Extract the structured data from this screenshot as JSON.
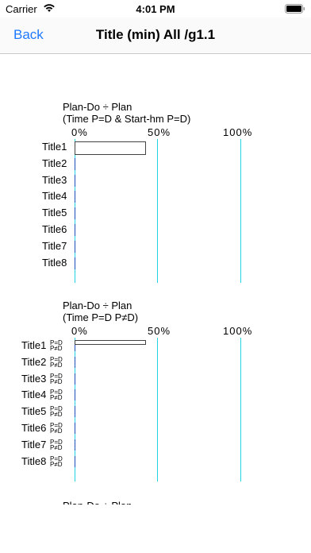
{
  "status": {
    "carrier": "Carrier",
    "time": "4:01 PM"
  },
  "nav": {
    "back_label": "Back",
    "title": "Title (min) All /g1.1"
  },
  "axis": {
    "p0": "0%",
    "p50": "50%",
    "p100": "100%"
  },
  "charts": [
    {
      "title_line1": "Plan-Do ÷ Plan",
      "title_line2": "(Time P=D & Start-hm P=D)",
      "rows": [
        "Title1",
        "Title2",
        "Title3",
        "Title4",
        "Title5",
        "Title6",
        "Title7",
        "Title8"
      ]
    },
    {
      "title_line1": "Plan-Do ÷ Plan",
      "title_line2": "(Time P=D P≠D)",
      "rows": [
        "Title1",
        "Title2",
        "Title3",
        "Title4",
        "Title5",
        "Title6",
        "Title7",
        "Title8"
      ],
      "pd_eq": "P=D",
      "pd_ne": "P≠D"
    }
  ],
  "chart_data": [
    {
      "type": "bar",
      "title": "Plan-Do ÷ Plan (Time P=D & Start-hm P=D)",
      "categories": [
        "Title1",
        "Title2",
        "Title3",
        "Title4",
        "Title5",
        "Title6",
        "Title7",
        "Title8"
      ],
      "values": [
        43,
        0,
        0,
        0,
        0,
        0,
        0,
        0
      ],
      "xlim": [
        0,
        100
      ]
    },
    {
      "type": "bar",
      "title": "Plan-Do ÷ Plan (Time P=D P≠D)",
      "categories": [
        "Title1",
        "Title2",
        "Title3",
        "Title4",
        "Title5",
        "Title6",
        "Title7",
        "Title8"
      ],
      "series": [
        {
          "name": "P=D",
          "values": [
            43,
            0,
            0,
            0,
            0,
            0,
            0,
            0
          ]
        },
        {
          "name": "P≠D",
          "values": [
            0,
            0,
            0,
            0,
            0,
            0,
            0,
            0
          ]
        }
      ],
      "xlim": [
        0,
        100
      ]
    }
  ],
  "cut_off_text": "Plan-Do ÷ Plan"
}
